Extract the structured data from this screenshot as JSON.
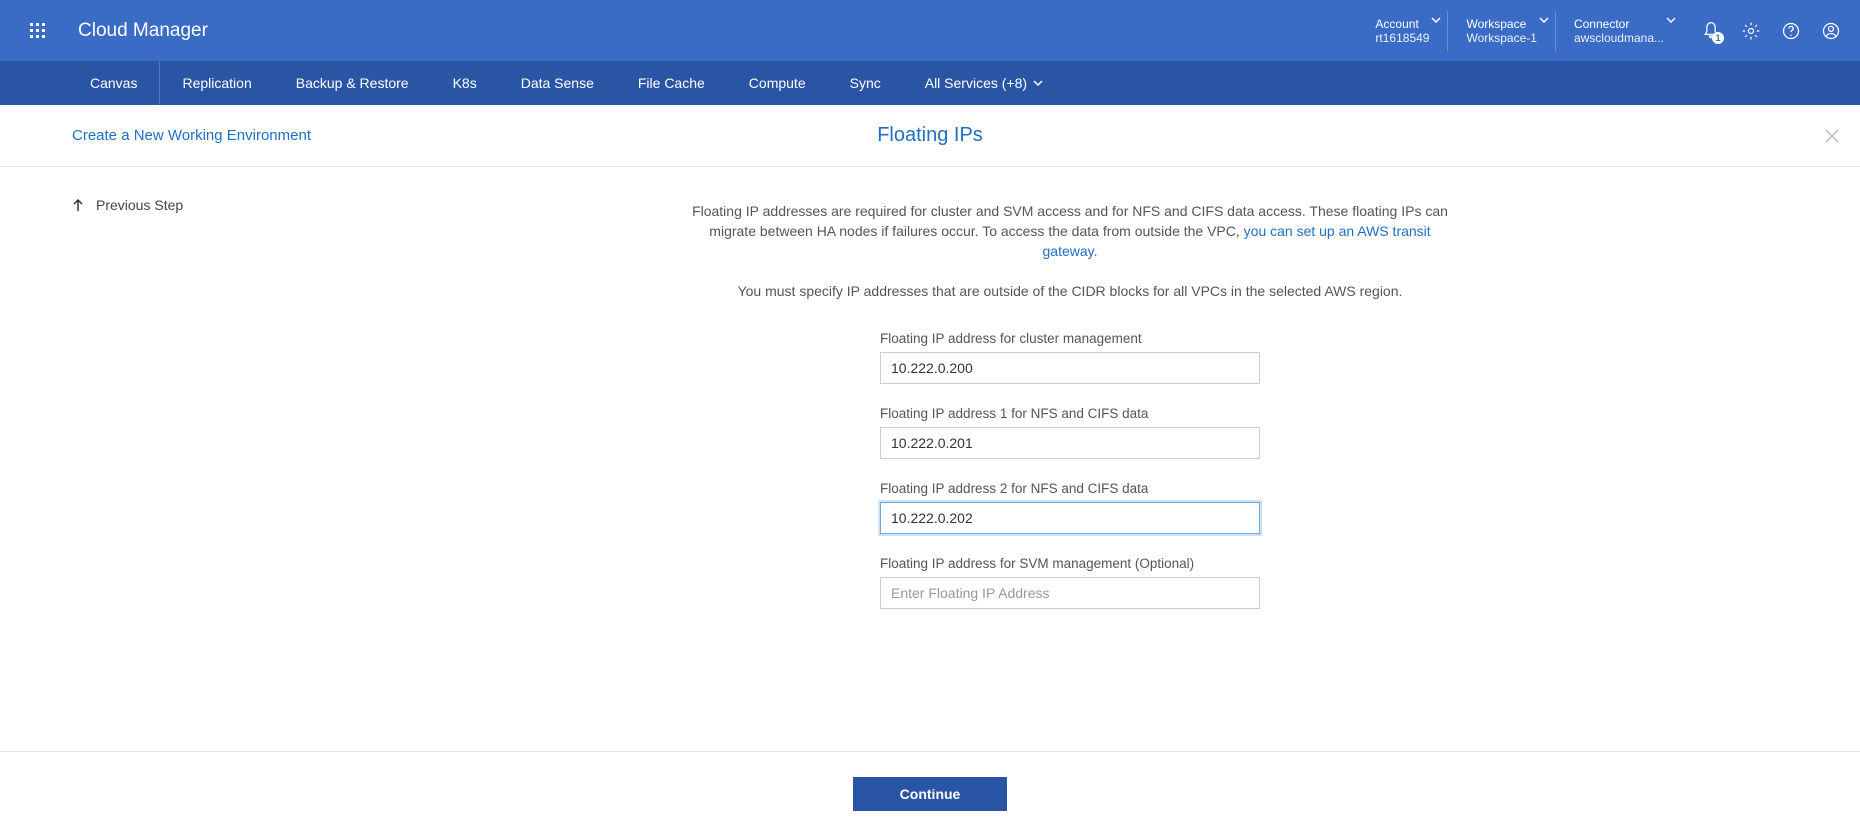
{
  "header": {
    "app_title": "Cloud Manager",
    "account": {
      "label": "Account",
      "value": "rt1618549"
    },
    "workspace": {
      "label": "Workspace",
      "value": "Workspace-1"
    },
    "connector": {
      "label": "Connector",
      "value": "awscloudmana..."
    },
    "notification_count": "1"
  },
  "nav": {
    "items": [
      "Canvas",
      "Replication",
      "Backup & Restore",
      "K8s",
      "Data Sense",
      "File Cache",
      "Compute",
      "Sync"
    ],
    "all_services": "All Services (+8)"
  },
  "subheader": {
    "breadcrumb": "Create a New Working Environment",
    "title": "Floating IPs"
  },
  "sidebar": {
    "previous_step": "Previous Step"
  },
  "content": {
    "desc_part1": "Floating IP addresses are required for cluster and SVM access and for NFS and CIFS data access. These floating IPs can migrate between HA nodes if failures occur. To access the data from outside the VPC, ",
    "desc_link": "you can set up an AWS transit gateway.",
    "desc2": "You must specify IP addresses that are outside of the CIDR blocks for all VPCs in the selected AWS region."
  },
  "form": {
    "cluster_mgmt": {
      "label": "Floating IP address for cluster management",
      "value": "10.222.0.200"
    },
    "nfs1": {
      "label": "Floating IP address 1 for NFS and CIFS data",
      "value": "10.222.0.201"
    },
    "nfs2": {
      "label": "Floating IP address 2 for NFS and CIFS data",
      "value": "10.222.0.202"
    },
    "svm_mgmt": {
      "label": "Floating IP address for SVM management (Optional)",
      "value": "",
      "placeholder": "Enter Floating IP Address"
    }
  },
  "footer": {
    "continue": "Continue"
  }
}
